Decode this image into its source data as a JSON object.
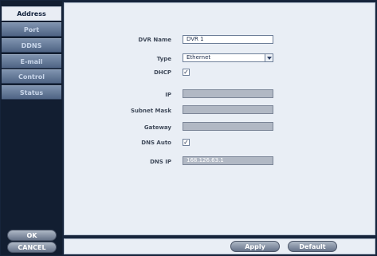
{
  "sidebar": {
    "tabs": [
      {
        "label": "Address"
      },
      {
        "label": "Port"
      },
      {
        "label": "DDNS"
      },
      {
        "label": "E-mail"
      },
      {
        "label": "Control"
      },
      {
        "label": "Status"
      }
    ],
    "ok_label": "OK",
    "cancel_label": "CANCEL"
  },
  "form": {
    "dvr_name": {
      "label": "DVR Name",
      "value": "DVR 1"
    },
    "type": {
      "label": "Type",
      "value": "Ethernet"
    },
    "dhcp": {
      "label": "DHCP",
      "checked": true,
      "mark": "✓"
    },
    "ip": {
      "label": "IP",
      "value": ""
    },
    "subnet_mask": {
      "label": "Subnet Mask",
      "value": ""
    },
    "gateway": {
      "label": "Gateway",
      "value": ""
    },
    "dns_auto": {
      "label": "DNS Auto",
      "checked": true,
      "mark": "✓"
    },
    "dns_ip": {
      "label": "DNS IP",
      "value": "168.126.63.1"
    }
  },
  "footer": {
    "apply_label": "Apply",
    "default_label": "Default"
  },
  "icons": {
    "type_dropdown": "chevron-down-icon",
    "dhcp_check": "checkmark-icon",
    "dns_auto_check": "checkmark-icon"
  },
  "colors": {
    "background": "#16243b",
    "panel": "#e9eef5",
    "tab_inactive": "#5f7393",
    "tab_active": "#e9edf4",
    "disabled_field": "#b1b8c4",
    "label_text": "#404a5a",
    "value_text": "#1a2b4a"
  }
}
